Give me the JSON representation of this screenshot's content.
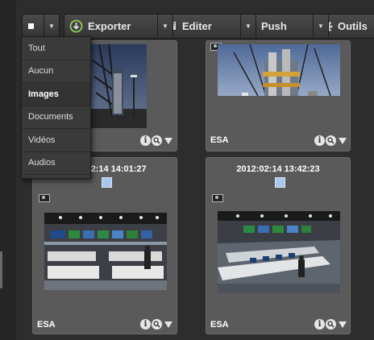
{
  "toolbar": {
    "selector": {
      "icon": "square-icon"
    },
    "export": {
      "label": "Exporter",
      "icon": "export-icon"
    },
    "edit": {
      "label": "Editer",
      "icon": "edit-icon"
    },
    "push": {
      "label": "Push",
      "icon": "push-icon"
    },
    "tools": {
      "label": "Outils",
      "icon": "gear-icon"
    }
  },
  "filter_menu": {
    "items": [
      "Tout",
      "Aucun",
      "Images",
      "Documents",
      "Vidéos",
      "Audios"
    ],
    "selected": "Images"
  },
  "cards": [
    {
      "date": "",
      "source": "",
      "thumbnail": "rocket-launch-pad"
    },
    {
      "date": "",
      "source": "ESA",
      "thumbnail": "rocket-launch-tower"
    },
    {
      "date": "2012:02:14 14:01:27",
      "source": "ESA",
      "thumbnail": "mission-control-room"
    },
    {
      "date": "2012:02:14 13:42:23",
      "source": "ESA",
      "thumbnail": "mission-control-room"
    }
  ],
  "colors": {
    "accent_checkbox": "#a9c8ee",
    "card_bg": "#5a5a5a",
    "page_bg": "#2d2d2d"
  }
}
